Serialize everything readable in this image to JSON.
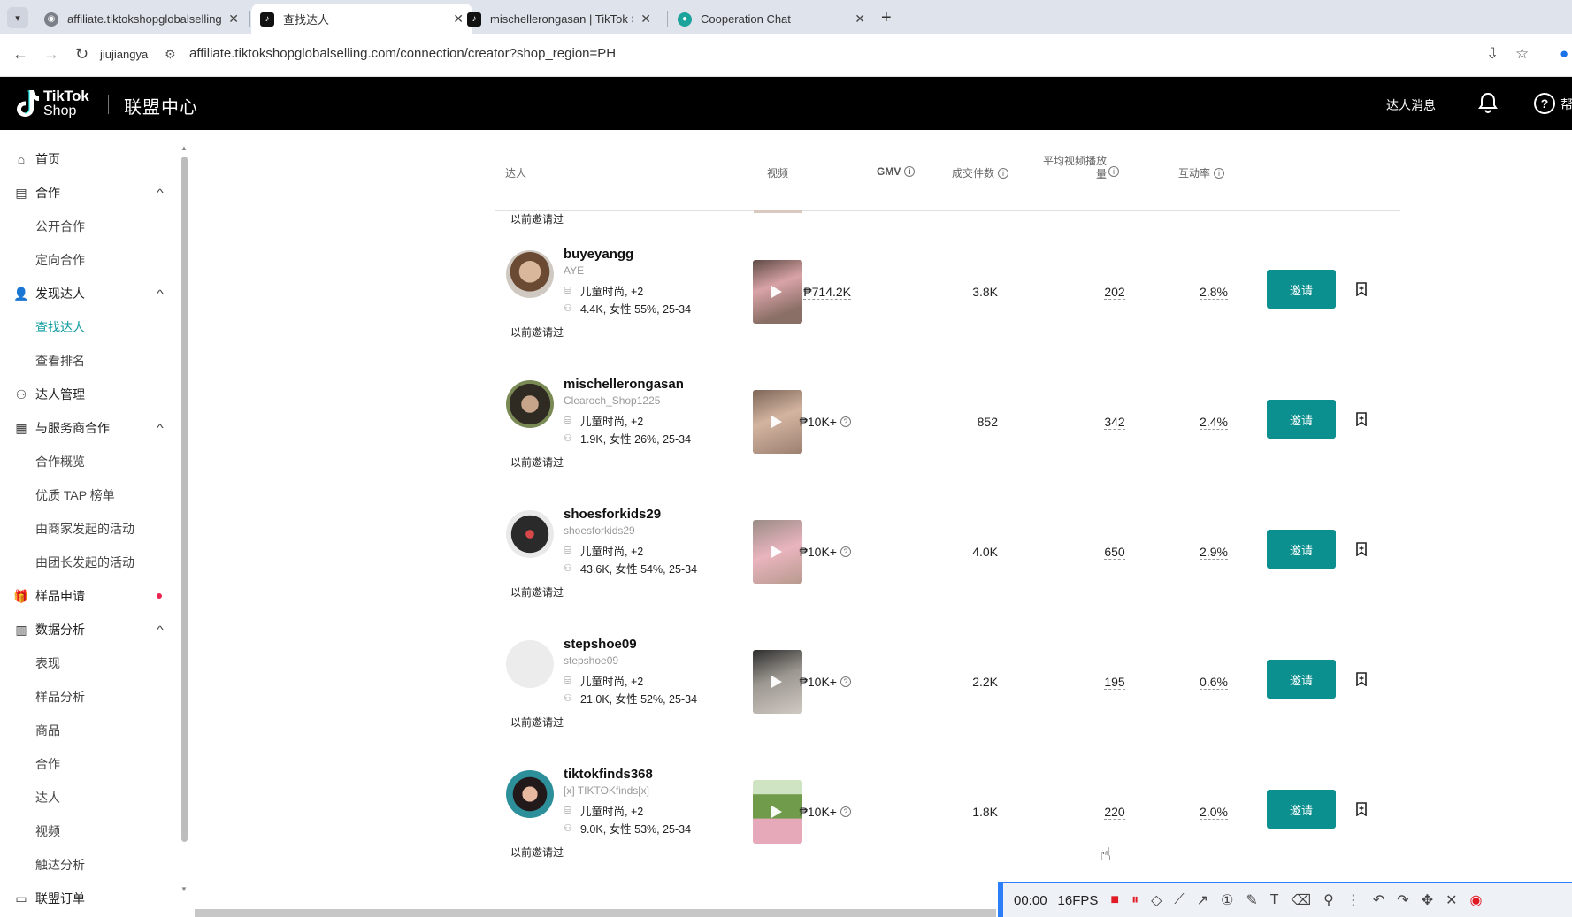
{
  "browser": {
    "tabs": [
      {
        "title": "affiliate.tiktokshopglobalselling",
        "active": false,
        "favicon": "globe-icon"
      },
      {
        "title": "查找达人",
        "active": true,
        "favicon": "tiktok-icon"
      },
      {
        "title": "mischellerongasan | TikTok S",
        "active": false,
        "favicon": "tiktok-icon"
      },
      {
        "title": "Cooperation Chat",
        "active": false,
        "favicon": "chat-icon"
      }
    ],
    "profile": "jiujiangya",
    "url": "affiliate.tiktokshopglobalselling.com/connection/creator?shop_region=PH"
  },
  "header": {
    "logo_line1": "TikTok",
    "logo_line2": "Shop",
    "title": "联盟中心",
    "messages": "达人消息",
    "help": "帮"
  },
  "sidebar": {
    "items": [
      {
        "label": "首页",
        "icon": "home-icon",
        "level": 0
      },
      {
        "label": "合作",
        "icon": "cooperation-icon",
        "level": 0,
        "expanded": true
      },
      {
        "label": "公开合作",
        "level": 1
      },
      {
        "label": "定向合作",
        "level": 1
      },
      {
        "label": "发现达人",
        "icon": "find-creator-icon",
        "level": 0,
        "expanded": true
      },
      {
        "label": "查找达人",
        "level": 1,
        "active": true
      },
      {
        "label": "查看排名",
        "level": 1
      },
      {
        "label": "达人管理",
        "icon": "creator-manage-icon",
        "level": 0
      },
      {
        "label": "与服务商合作",
        "icon": "partner-icon",
        "level": 0,
        "expanded": true
      },
      {
        "label": "合作概览",
        "level": 1
      },
      {
        "label": "优质 TAP 榜单",
        "level": 1
      },
      {
        "label": "由商家发起的活动",
        "level": 1
      },
      {
        "label": "由团长发起的活动",
        "level": 1
      },
      {
        "label": "样品申请",
        "icon": "gift-icon",
        "level": 0,
        "dot": true
      },
      {
        "label": "数据分析",
        "icon": "analytics-icon",
        "level": 0,
        "expanded": true
      },
      {
        "label": "表现",
        "level": 1
      },
      {
        "label": "样品分析",
        "level": 1
      },
      {
        "label": "商品",
        "level": 1
      },
      {
        "label": "合作",
        "level": 1
      },
      {
        "label": "达人",
        "level": 1
      },
      {
        "label": "视频",
        "level": 1
      },
      {
        "label": "触达分析",
        "level": 1
      },
      {
        "label": "联盟订单",
        "icon": "orders-icon",
        "level": 0
      }
    ]
  },
  "table": {
    "headers": {
      "creator": "达人",
      "video": "视频",
      "gmv": "GMV",
      "sales": "成交件数",
      "avg_views": "平均视频播放量",
      "engagement": "互动率"
    },
    "prev_row_invited": "以前邀请过",
    "invite_label": "邀请",
    "rows": [
      {
        "name": "buyeyangg",
        "handle": "AYE",
        "category": "儿童时尚, +2",
        "audience": "4.4K, 女性 55%, 25-34",
        "invited": "以前邀请过",
        "gmv": "₱714.2K",
        "gmv_info": false,
        "sales": "3.8K",
        "views": "202",
        "engagement": "2.8%"
      },
      {
        "name": "mischellerongasan",
        "handle": "Clearoch_Shop1225",
        "category": "儿童时尚, +2",
        "audience": "1.9K, 女性 26%, 25-34",
        "invited": "以前邀请过",
        "gmv": "₱10K+",
        "gmv_info": true,
        "sales": "852",
        "views": "342",
        "engagement": "2.4%"
      },
      {
        "name": "shoesforkids29",
        "handle": "shoesforkids29",
        "category": "儿童时尚, +2",
        "audience": "43.6K, 女性 54%, 25-34",
        "invited": "以前邀请过",
        "gmv": "₱10K+",
        "gmv_info": true,
        "sales": "4.0K",
        "views": "650",
        "engagement": "2.9%"
      },
      {
        "name": "stepshoe09",
        "handle": "stepshoe09",
        "category": "儿童时尚, +2",
        "audience": "21.0K, 女性 52%, 25-34",
        "invited": "以前邀请过",
        "gmv": "₱10K+",
        "gmv_info": true,
        "sales": "2.2K",
        "views": "195",
        "engagement": "0.6%"
      },
      {
        "name": "tiktokfinds368",
        "handle": "[x] TIKTOKfinds[x]",
        "category": "儿童时尚, +2",
        "audience": "9.0K, 女性 53%, 25-34",
        "invited": "以前邀请过",
        "gmv": "₱10K+",
        "gmv_info": true,
        "sales": "1.8K",
        "views": "220",
        "engagement": "2.0%"
      }
    ]
  },
  "recorder": {
    "time": "00:00",
    "fps": "16FPS"
  },
  "colors": {
    "accent": "#0b8f8f",
    "active_nav": "#0d9a9e",
    "header_bg": "#000000",
    "dot": "#e8264f"
  }
}
